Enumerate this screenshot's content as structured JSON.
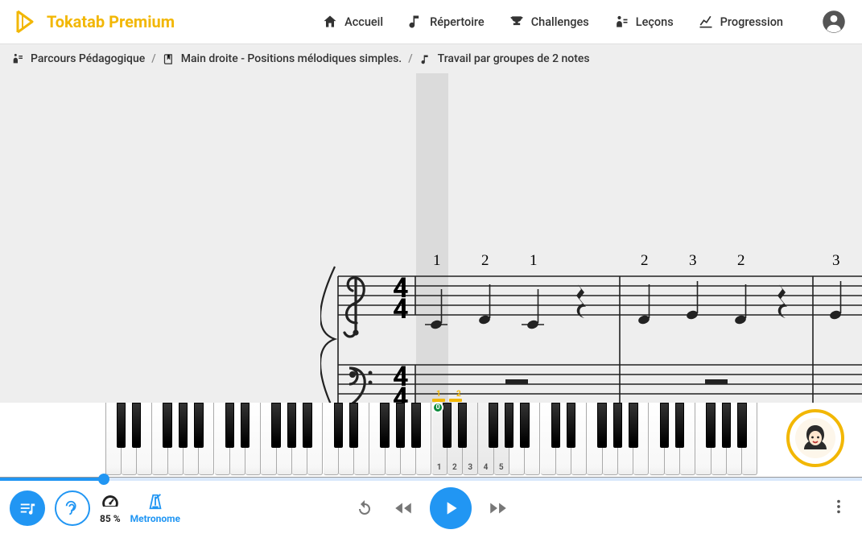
{
  "brand": "Tokatab Premium",
  "nav": {
    "home": "Accueil",
    "rep": "Répertoire",
    "chal": "Challenges",
    "lessons": "Leçons",
    "prog": "Progression"
  },
  "breadcrumb": {
    "a": "Parcours Pédagogique",
    "b": "Main droite - Positions mélodiques simples.",
    "c": "Travail par groupes de 2 notes"
  },
  "controls": {
    "tempo_label": "85 %",
    "metronome": "Metronome",
    "progress_pct": 12
  },
  "piano": {
    "middle_c_marker": "0",
    "finger_labels": [
      "1",
      "2",
      "3",
      "4",
      "5"
    ],
    "hints": [
      "1",
      "2"
    ]
  },
  "score": {
    "time_sig_top": "4",
    "time_sig_bottom": "4",
    "measures": [
      {
        "fingerings": [
          "1",
          "2",
          "1"
        ],
        "notes": [
          "C4",
          "D4",
          "C4"
        ],
        "rest": "quarter"
      },
      {
        "fingerings": [
          "2",
          "3",
          "2"
        ],
        "notes": [
          "D4",
          "E4",
          "D4"
        ],
        "rest": "quarter"
      },
      {
        "fingerings": [
          "3"
        ],
        "notes": [
          "E4"
        ]
      }
    ]
  }
}
